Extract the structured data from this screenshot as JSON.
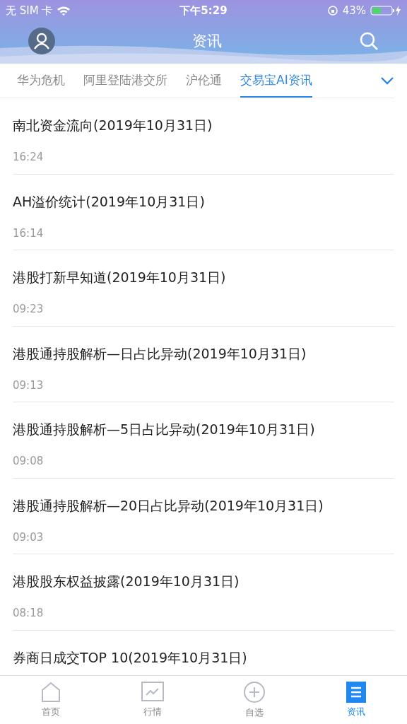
{
  "status_bar": {
    "carrier": "无 SIM 卡",
    "time": "下午5:29",
    "battery": "43%"
  },
  "header": {
    "title": "资讯"
  },
  "tabs": [
    {
      "label": "华为危机",
      "selected": false
    },
    {
      "label": "阿里登陆港交所",
      "selected": false
    },
    {
      "label": "沪伦通",
      "selected": false
    },
    {
      "label": "交易宝AI资讯",
      "selected": true
    }
  ],
  "news": [
    {
      "title": "南北资金流向(2019年10月31日)",
      "time": "16:24"
    },
    {
      "title": "AH溢价统计(2019年10月31日)",
      "time": "16:14"
    },
    {
      "title": "港股打新早知道(2019年10月31日)",
      "time": "09:23"
    },
    {
      "title": "港股通持股解析—日占比异动(2019年10月31日)",
      "time": "09:13"
    },
    {
      "title": "港股通持股解析—5日占比异动(2019年10月31日)",
      "time": "09:08"
    },
    {
      "title": "港股通持股解析—20日占比异动(2019年10月31日)",
      "time": "09:03"
    },
    {
      "title": "港股股东权益披露(2019年10月31日)",
      "time": "08:18"
    },
    {
      "title": "券商日成交TOP 10(2019年10月31日)"
    }
  ],
  "bottom_nav": [
    {
      "label": "首页",
      "selected": false
    },
    {
      "label": "行情",
      "selected": false
    },
    {
      "label": "自选",
      "selected": false
    },
    {
      "label": "资讯",
      "selected": true
    }
  ]
}
